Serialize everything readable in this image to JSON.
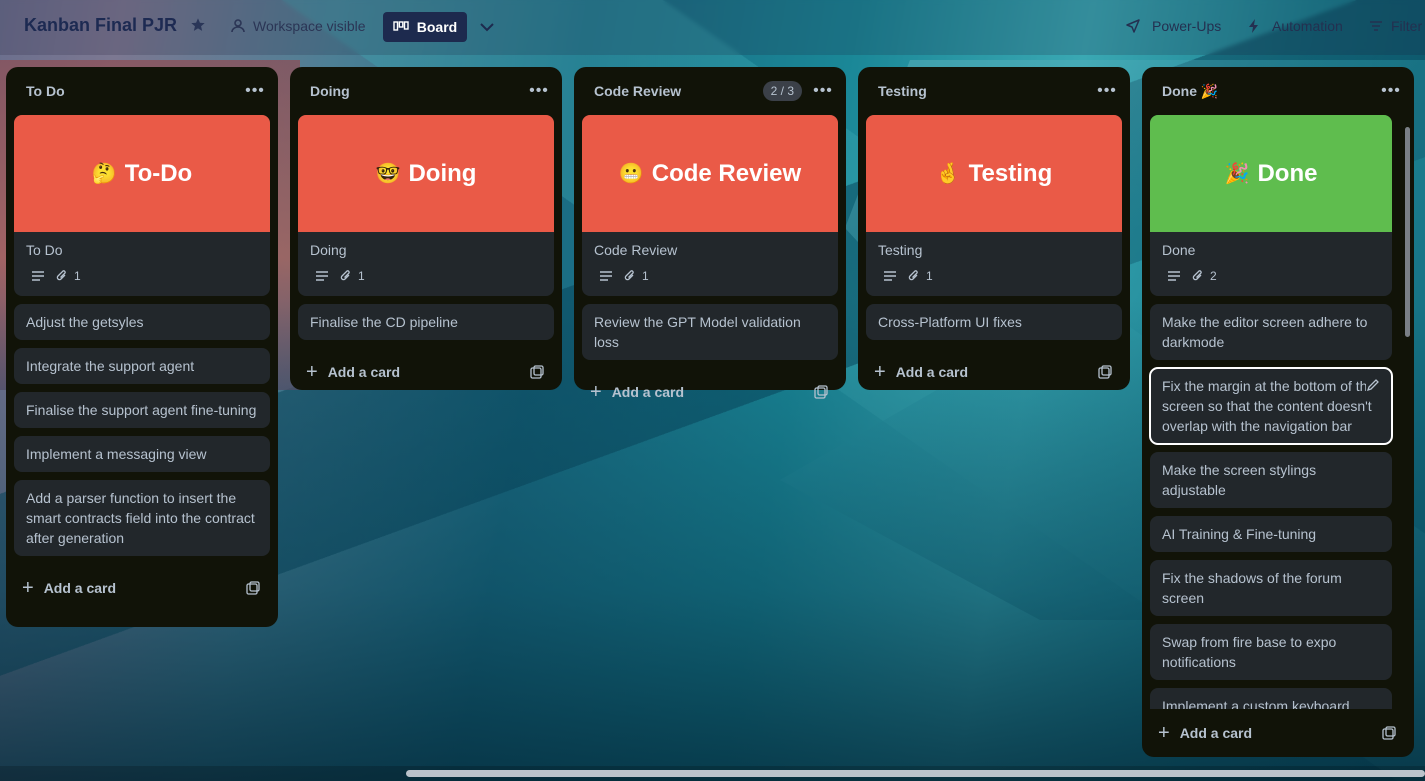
{
  "header": {
    "board_title": "Kanban Final PJR",
    "visibility": "Workspace visible",
    "view_button": "Board",
    "power_ups": "Power-Ups",
    "automation": "Automation",
    "filter": "Filter"
  },
  "colors": {
    "cover_red": "#ea5a47",
    "cover_green": "#5fbd4e",
    "list_bg": "#111308",
    "card_bg": "#22272b",
    "board_button_bg": "#1d2a4e"
  },
  "lists": [
    {
      "title": "To Do",
      "cover_card": {
        "cover_emoji": "🤔",
        "cover_text": "To-Do",
        "title": "To Do",
        "attachments": "1"
      },
      "cards": [
        "Adjust the getsyles",
        "Integrate the support agent",
        "Finalise the support agent fine-tuning",
        "Implement a messaging view",
        "Add a parser function to insert the smart contracts field into the contract after generation"
      ],
      "add_card": "Add a card"
    },
    {
      "title": "Doing",
      "cover_card": {
        "cover_emoji": "🤓",
        "cover_text": "Doing",
        "title": "Doing",
        "attachments": "1"
      },
      "cards": [
        "Finalise the CD pipeline"
      ],
      "add_card": "Add a card"
    },
    {
      "title": "Code Review",
      "count": "2 / 3",
      "cover_card": {
        "cover_emoji": "😬",
        "cover_text": "Code Review",
        "title": "Code Review",
        "attachments": "1"
      },
      "cards": [
        "Review the GPT Model validation loss"
      ],
      "add_card": "Add a card"
    },
    {
      "title": "Testing",
      "cover_card": {
        "cover_emoji": "🤞",
        "cover_text": "Testing",
        "title": "Testing",
        "attachments": "1"
      },
      "cards": [
        "Cross-Platform UI fixes"
      ],
      "add_card": "Add a card"
    },
    {
      "title": "Done 🎉",
      "cover_card": {
        "cover_emoji": "🎉",
        "cover_text": "Done",
        "title": "Done",
        "attachments": "2"
      },
      "cards": [
        "Make the editor screen adhere to darkmode",
        "Fix the margin at the bottom of the screen so that the content doesn't overlap with the navigation bar",
        "Make the screen stylings adjustable",
        "AI Training & Fine-tuning",
        "Fix the shadows of the forum screen",
        "Swap from fire base to expo notifications",
        "Implement a custom keyboard avoiding view"
      ],
      "add_card": "Add a card"
    }
  ]
}
